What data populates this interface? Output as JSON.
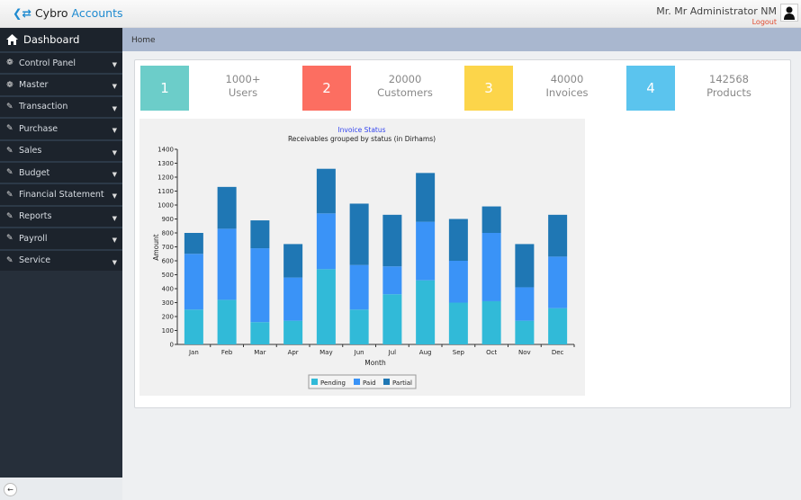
{
  "header": {
    "brand_prefix": "Cybro",
    "brand_suffix": "Accounts",
    "user": "Mr. Mr Administrator NM",
    "logout": "Logout"
  },
  "sidebar": {
    "dashboard": "Dashboard",
    "items": [
      {
        "label": "Control Panel",
        "icon": "cogs-icon"
      },
      {
        "label": "Master",
        "icon": "cogs-icon"
      },
      {
        "label": "Transaction",
        "icon": "edit-icon"
      },
      {
        "label": "Purchase",
        "icon": "edit-icon"
      },
      {
        "label": "Sales",
        "icon": "edit-icon"
      },
      {
        "label": "Budget",
        "icon": "edit-icon"
      },
      {
        "label": "Financial Statement",
        "icon": "edit-icon"
      },
      {
        "label": "Reports",
        "icon": "edit-icon"
      },
      {
        "label": "Payroll",
        "icon": "edit-icon"
      },
      {
        "label": "Service",
        "icon": "edit-icon"
      }
    ]
  },
  "breadcrumb": "Home",
  "stats": [
    {
      "num": "1",
      "value": "1000+",
      "label": "Users",
      "color": "#6ccdc9"
    },
    {
      "num": "2",
      "value": "20000",
      "label": "Customers",
      "color": "#fc6e61"
    },
    {
      "num": "3",
      "value": "40000",
      "label": "Invoices",
      "color": "#fcd54a"
    },
    {
      "num": "4",
      "value": "142568",
      "label": "Products",
      "color": "#5bc4ee"
    }
  ],
  "chart_data": {
    "type": "bar",
    "stacked": true,
    "title": "Invoice Status",
    "subtitle": "Receivables grouped by status (in Dirhams)",
    "xlabel": "Month",
    "ylabel": "Amount",
    "ylim": [
      0,
      1400
    ],
    "yticks": [
      0,
      100,
      200,
      300,
      400,
      500,
      600,
      700,
      800,
      900,
      1000,
      1100,
      1200,
      1300,
      1400
    ],
    "categories": [
      "Jan",
      "Feb",
      "Mar",
      "Apr",
      "May",
      "Jun",
      "Jul",
      "Aug",
      "Sep",
      "Oct",
      "Nov",
      "Dec"
    ],
    "series": [
      {
        "name": "Pending",
        "color": "#31bad8",
        "values": [
          250,
          320,
          160,
          170,
          540,
          250,
          360,
          460,
          300,
          310,
          170,
          260
        ]
      },
      {
        "name": "Paid",
        "color": "#3a93f7",
        "values": [
          400,
          510,
          530,
          310,
          400,
          320,
          200,
          420,
          300,
          490,
          240,
          370
        ]
      },
      {
        "name": "Partial",
        "color": "#1f77b4",
        "values": [
          150,
          300,
          200,
          240,
          320,
          440,
          370,
          350,
          300,
          190,
          310,
          300
        ]
      }
    ],
    "legend": "bottom"
  }
}
